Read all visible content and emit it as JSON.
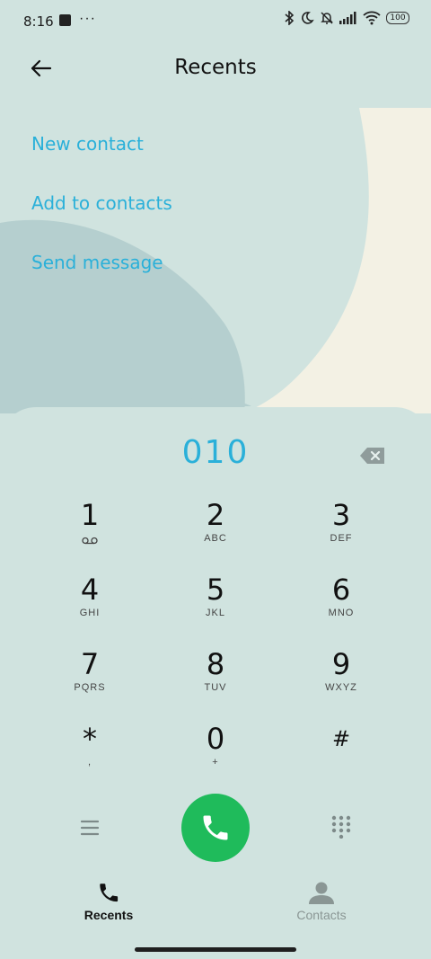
{
  "status_bar": {
    "time": "8:16",
    "dots": "···",
    "battery": "100"
  },
  "header": {
    "title": "Recents",
    "back_icon": "arrow-left-icon"
  },
  "menu": {
    "new_contact": "New contact",
    "add_to_contacts": "Add to contacts",
    "send_message": "Send message"
  },
  "dialpad": {
    "number": "010",
    "keys": [
      {
        "digit": "1",
        "letters": ""
      },
      {
        "digit": "2",
        "letters": "ABC"
      },
      {
        "digit": "3",
        "letters": "DEF"
      },
      {
        "digit": "4",
        "letters": "GHI"
      },
      {
        "digit": "5",
        "letters": "JKL"
      },
      {
        "digit": "6",
        "letters": "MNO"
      },
      {
        "digit": "7",
        "letters": "PQRS"
      },
      {
        "digit": "8",
        "letters": "TUV"
      },
      {
        "digit": "9",
        "letters": "WXYZ"
      },
      {
        "digit": "*",
        "letters": ","
      },
      {
        "digit": "0",
        "letters": "+"
      },
      {
        "digit": "#",
        "letters": ""
      }
    ]
  },
  "tabs": {
    "recents": "Recents",
    "contacts": "Contacts"
  },
  "colors": {
    "accent": "#2ab0d9",
    "call": "#1fbb5b",
    "background": "#d0e3df"
  }
}
